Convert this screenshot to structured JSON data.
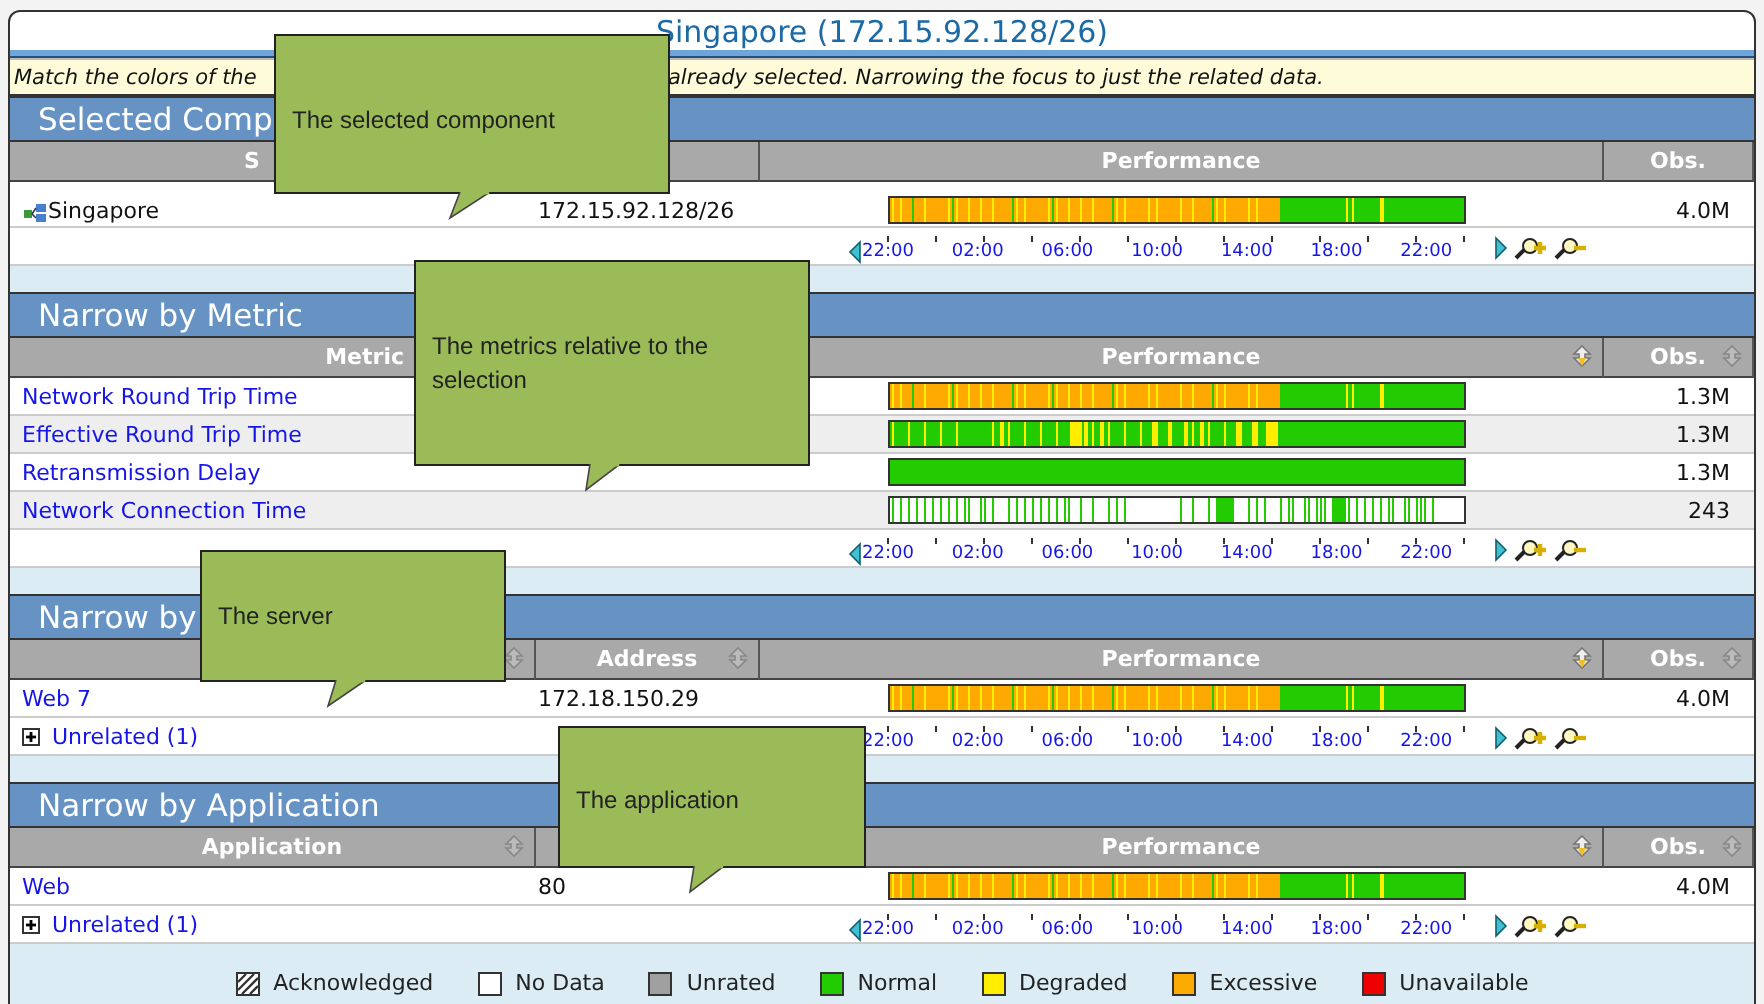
{
  "title": "Singapore (172.15.92.128/26)",
  "hint": [
    "Match the colors of the",
    "already selected. Narrowing the focus to just the related data."
  ],
  "sections": [
    {
      "title": "Selected Comp",
      "columns": [
        {
          "kind": "name-cut",
          "label": "S"
        },
        {
          "kind": "performance",
          "label": "Performance"
        },
        {
          "kind": "obs",
          "label": "Obs."
        }
      ],
      "rows": [
        {
          "kind": "component",
          "name": "Singapore",
          "address": "172.15.92.128/26",
          "bar": {
            "kind": "excessive"
          },
          "obs": "4.0M"
        }
      ],
      "axis_labels": [
        "22:00",
        "02:00",
        "06:00",
        "10:00",
        "14:00",
        "18:00",
        "22:00"
      ]
    },
    {
      "title": "Narrow by Metric",
      "columns": [
        {
          "kind": "name-wide",
          "label": "Metric"
        },
        {
          "kind": "performance",
          "label": "Performance",
          "sort": {
            "kind": "down"
          }
        },
        {
          "kind": "obs",
          "label": "Obs.",
          "sort": {
            "kind": "both"
          }
        }
      ],
      "rows": [
        {
          "kind": "link",
          "name": "Network Round Trip Time",
          "bar": {
            "kind": "excessive"
          },
          "obs": "1.3M"
        },
        {
          "kind": "link",
          "name": "Effective Round Trip Time",
          "bar": {
            "kind": "degraded"
          },
          "obs": "1.3M"
        },
        {
          "kind": "link",
          "name": "Retransmission Delay",
          "bar": {
            "kind": "normal"
          },
          "obs": "1.3M"
        },
        {
          "kind": "link",
          "name": "Network Connection Time",
          "bar": {
            "kind": "sparse"
          },
          "obs": "243"
        }
      ],
      "axis_labels": [
        "22:00",
        "02:00",
        "06:00",
        "10:00",
        "14:00",
        "18:00",
        "22:00"
      ]
    },
    {
      "title": "Narrow by",
      "columns": [
        {
          "kind": "name",
          "sort": {
            "kind": "both"
          }
        },
        {
          "kind": "address",
          "label": "Address",
          "sort": {
            "kind": "both"
          }
        },
        {
          "kind": "performance",
          "label": "Performance",
          "sort": {
            "kind": "down"
          }
        },
        {
          "kind": "obs",
          "label": "Obs.",
          "sort": {
            "kind": "both"
          }
        }
      ],
      "rows": [
        {
          "kind": "link",
          "name": "Web 7",
          "address": "172.18.150.29",
          "bar": {
            "kind": "excessive"
          },
          "obs": "4.0M"
        }
      ],
      "group": {
        "label": "Unrelated (1)",
        "expanded": false
      },
      "axis_labels": [
        "22:00",
        "02:00",
        "06:00",
        "10:00",
        "14:00",
        "18:00",
        "22:00"
      ]
    },
    {
      "title": "Narrow by Application",
      "columns": [
        {
          "kind": "name",
          "label": "Application",
          "sort": {
            "kind": "both"
          }
        },
        {
          "kind": "address"
        },
        {
          "kind": "performance",
          "label": "Performance",
          "sort": {
            "kind": "down"
          }
        },
        {
          "kind": "obs",
          "label": "Obs.",
          "sort": {
            "kind": "both"
          }
        }
      ],
      "rows": [
        {
          "kind": "link",
          "name": "Web",
          "address": "80",
          "bar": {
            "kind": "excessive"
          },
          "obs": "4.0M"
        }
      ],
      "group": {
        "label": "Unrelated (1)",
        "expanded": false
      },
      "axis_labels": [
        "22:00",
        "02:00",
        "06:00",
        "10:00",
        "14:00",
        "18:00",
        "22:00"
      ]
    }
  ],
  "legend": [
    {
      "label": "Acknowledged",
      "kind": "hatched",
      "color": "#ffffff"
    },
    {
      "label": "No Data",
      "kind": "solid",
      "color": "#ffffff"
    },
    {
      "label": "Unrated",
      "kind": "solid",
      "color": "#a0a0a0"
    },
    {
      "label": "Normal",
      "kind": "solid",
      "color": "#22cc00"
    },
    {
      "label": "Degraded",
      "kind": "solid",
      "color": "#ffee00"
    },
    {
      "label": "Excessive",
      "kind": "solid",
      "color": "#ffaa00"
    },
    {
      "label": "Unavailable",
      "kind": "solid",
      "color": "#ee0000"
    }
  ],
  "callouts": [
    "The selected component",
    "The metrics relative to the selection",
    "The server",
    "The application"
  ]
}
